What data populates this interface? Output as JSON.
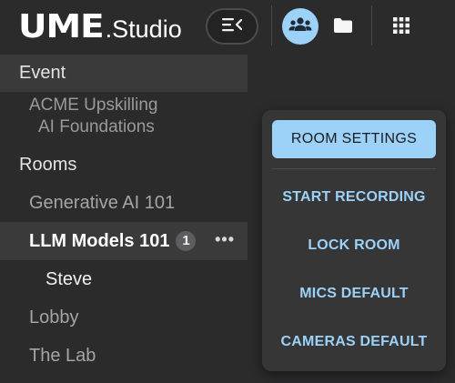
{
  "header": {
    "logo_mark": "UME",
    "logo_sub": ".Studio"
  },
  "icons": {
    "menu": "menu-collapse-icon",
    "people": "people-group-icon",
    "folder": "folder-icon",
    "apps": "apps-grid-icon"
  },
  "colors": {
    "background": "#2b2b2c",
    "accent": "#9cd1f8",
    "selected_row": "#3a3a3b"
  },
  "sidebar": {
    "event_header": "Event",
    "event_name_line1": "ACME Upskilling",
    "event_name_line2": "AI Foundations",
    "rooms_header": "Rooms",
    "rooms": [
      {
        "label": "Generative AI 101"
      },
      {
        "label": "LLM Models 101",
        "count": "1",
        "more": "•••"
      },
      {
        "label": "Lobby"
      },
      {
        "label": "The Lab"
      }
    ],
    "participant": "Steve"
  },
  "room_menu": {
    "primary": "ROOM SETTINGS",
    "items": [
      "START RECORDING",
      "LOCK ROOM",
      "MICS DEFAULT",
      "CAMERAS DEFAULT"
    ]
  }
}
